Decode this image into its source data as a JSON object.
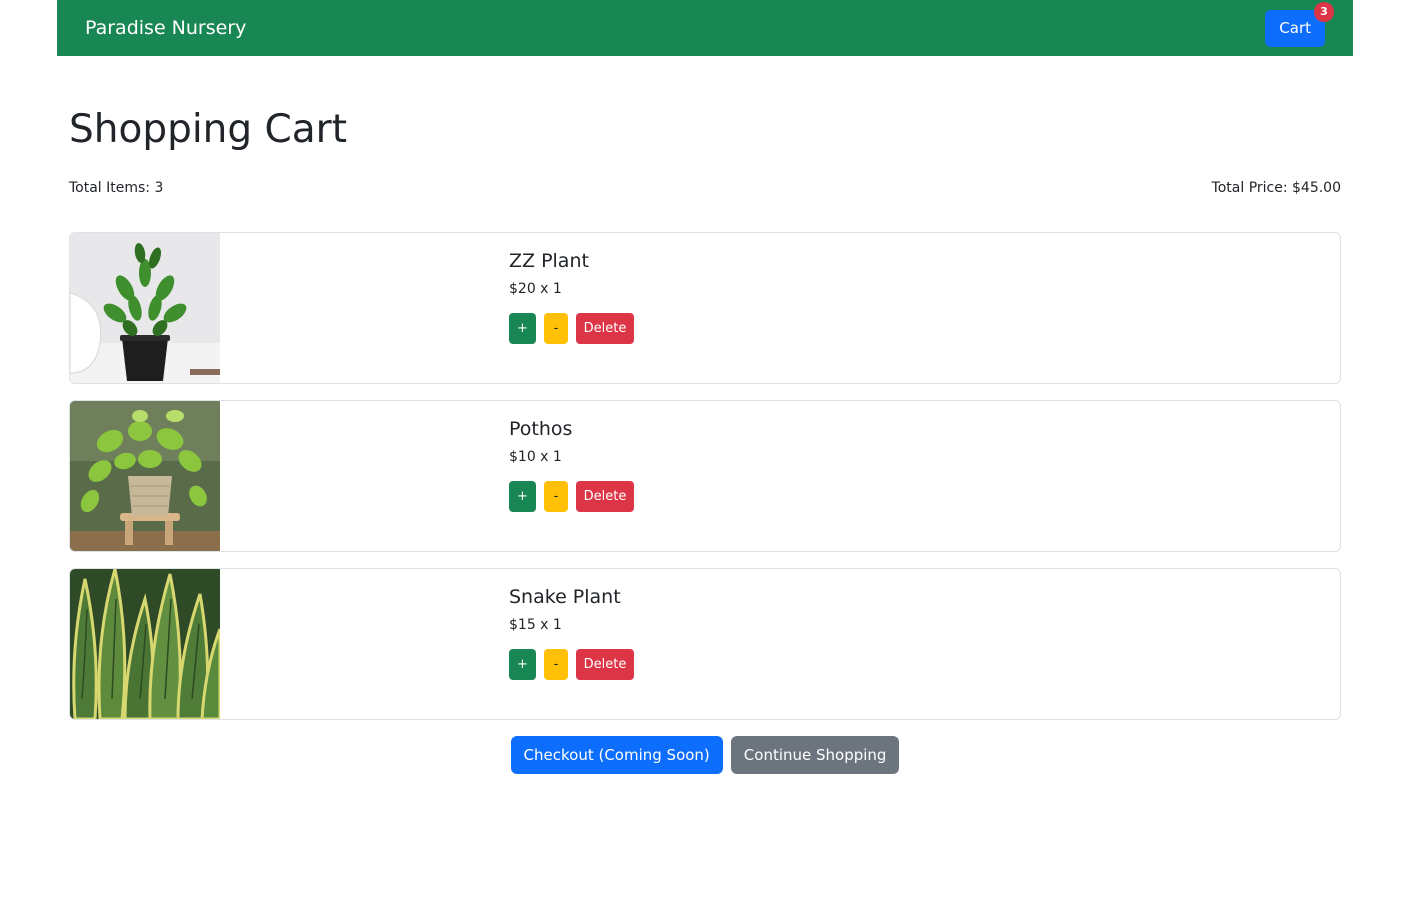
{
  "navbar": {
    "brand": "Paradise Nursery",
    "cart_label": "Cart",
    "cart_count": "3"
  },
  "page": {
    "title": "Shopping Cart",
    "total_items": "Total Items: 3",
    "total_price": "Total Price: $45.00"
  },
  "items": [
    {
      "name": "ZZ Plant",
      "price_line": "$20 x 1",
      "plus": "+",
      "minus": "-",
      "delete": "Delete"
    },
    {
      "name": "Pothos",
      "price_line": "$10 x 1",
      "plus": "+",
      "minus": "-",
      "delete": "Delete"
    },
    {
      "name": "Snake Plant",
      "price_line": "$15 x 1",
      "plus": "+",
      "minus": "-",
      "delete": "Delete"
    }
  ],
  "footer": {
    "checkout_label": "Checkout (Coming Soon)",
    "continue_label": "Continue Shopping"
  },
  "colors": {
    "navbar": "#198754",
    "primary": "#0d6efd",
    "danger": "#dc3545",
    "warning": "#ffc107",
    "secondary": "#6c757d"
  }
}
